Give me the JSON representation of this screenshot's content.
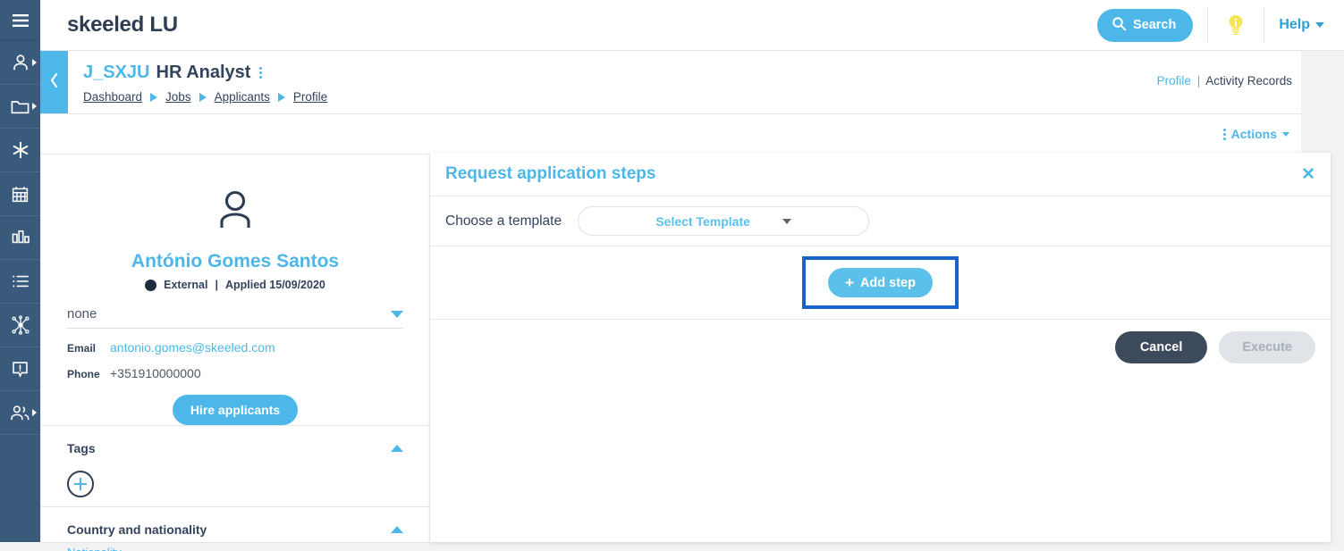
{
  "colors": {
    "brand_blue": "#4cb7e8",
    "dark_navy": "#33435c",
    "rail_bg": "#3a5a7c",
    "highlight_border": "#1a63c8",
    "bulb_yellow": "#f5e34f",
    "cancel_bg": "#3d4a5c",
    "execute_disabled": "#e0e3e8"
  },
  "rail": {
    "items": [
      {
        "name": "hamburger-menu",
        "icon": "hamburger-icon",
        "has_caret": false
      },
      {
        "name": "candidates",
        "icon": "person-icon",
        "has_caret": true
      },
      {
        "name": "jobs",
        "icon": "folder-icon",
        "has_caret": true
      },
      {
        "name": "favorites",
        "icon": "asterisk-icon",
        "has_caret": false
      },
      {
        "name": "calendar",
        "icon": "calendar-icon",
        "has_caret": false
      },
      {
        "name": "reports",
        "icon": "bar-chart-icon",
        "has_caret": false
      },
      {
        "name": "lists",
        "icon": "list-icon",
        "has_caret": false
      },
      {
        "name": "workflow",
        "icon": "network-icon",
        "has_caret": false
      },
      {
        "name": "alerts",
        "icon": "alert-box-icon",
        "has_caret": false
      },
      {
        "name": "teams",
        "icon": "people-group-icon",
        "has_caret": true
      }
    ]
  },
  "topbar": {
    "brand": "skeeled LU",
    "search_label": "Search",
    "search_icon": "search-icon",
    "info_icon": "lightbulb-info-icon",
    "help_label": "Help",
    "help_caret": "chevron-down-icon"
  },
  "pagehead": {
    "collapse_icon": "chevron-left-icon",
    "job_code": "J_SXJU",
    "job_title": "HR Analyst",
    "kebab_icon": "vertical-dots-icon",
    "breadcrumbs": [
      "Dashboard",
      "Jobs",
      "Applicants",
      "Profile"
    ],
    "right_links": {
      "active": "Profile",
      "separator": "|",
      "secondary": "Activity Records"
    }
  },
  "actionsbar": {
    "label": "Actions",
    "dots_icon": "vertical-dots-icon",
    "caret_icon": "chevron-down-icon"
  },
  "profile": {
    "avatar_icon": "person-avatar-icon",
    "name": "António Gomes Santos",
    "status_dot": "status-dot-icon",
    "source": "External",
    "meta_separator": "|",
    "applied": "Applied 15/09/2020",
    "stage_value": "none",
    "stage_caret": "caret-down-icon",
    "email_label": "Email",
    "email_value": "antonio.gomes@skeeled.com",
    "phone_label": "Phone",
    "phone_value": "+351910000000",
    "hire_label": "Hire applicants",
    "panels": [
      {
        "title": "Tags",
        "collapse_icon": "caret-up-icon",
        "add_icon": "plus-circle-icon"
      },
      {
        "title": "Country and nationality",
        "collapse_icon": "caret-up-icon",
        "peek": "Nationality"
      }
    ]
  },
  "modal": {
    "title": "Request application steps",
    "close_icon": "close-x-icon",
    "template_label": "Choose a template",
    "template_placeholder": "Select Template",
    "template_caret": "caret-down-icon",
    "add_step_label": "Add step",
    "add_step_plus": "+",
    "cancel_label": "Cancel",
    "execute_label": "Execute"
  }
}
